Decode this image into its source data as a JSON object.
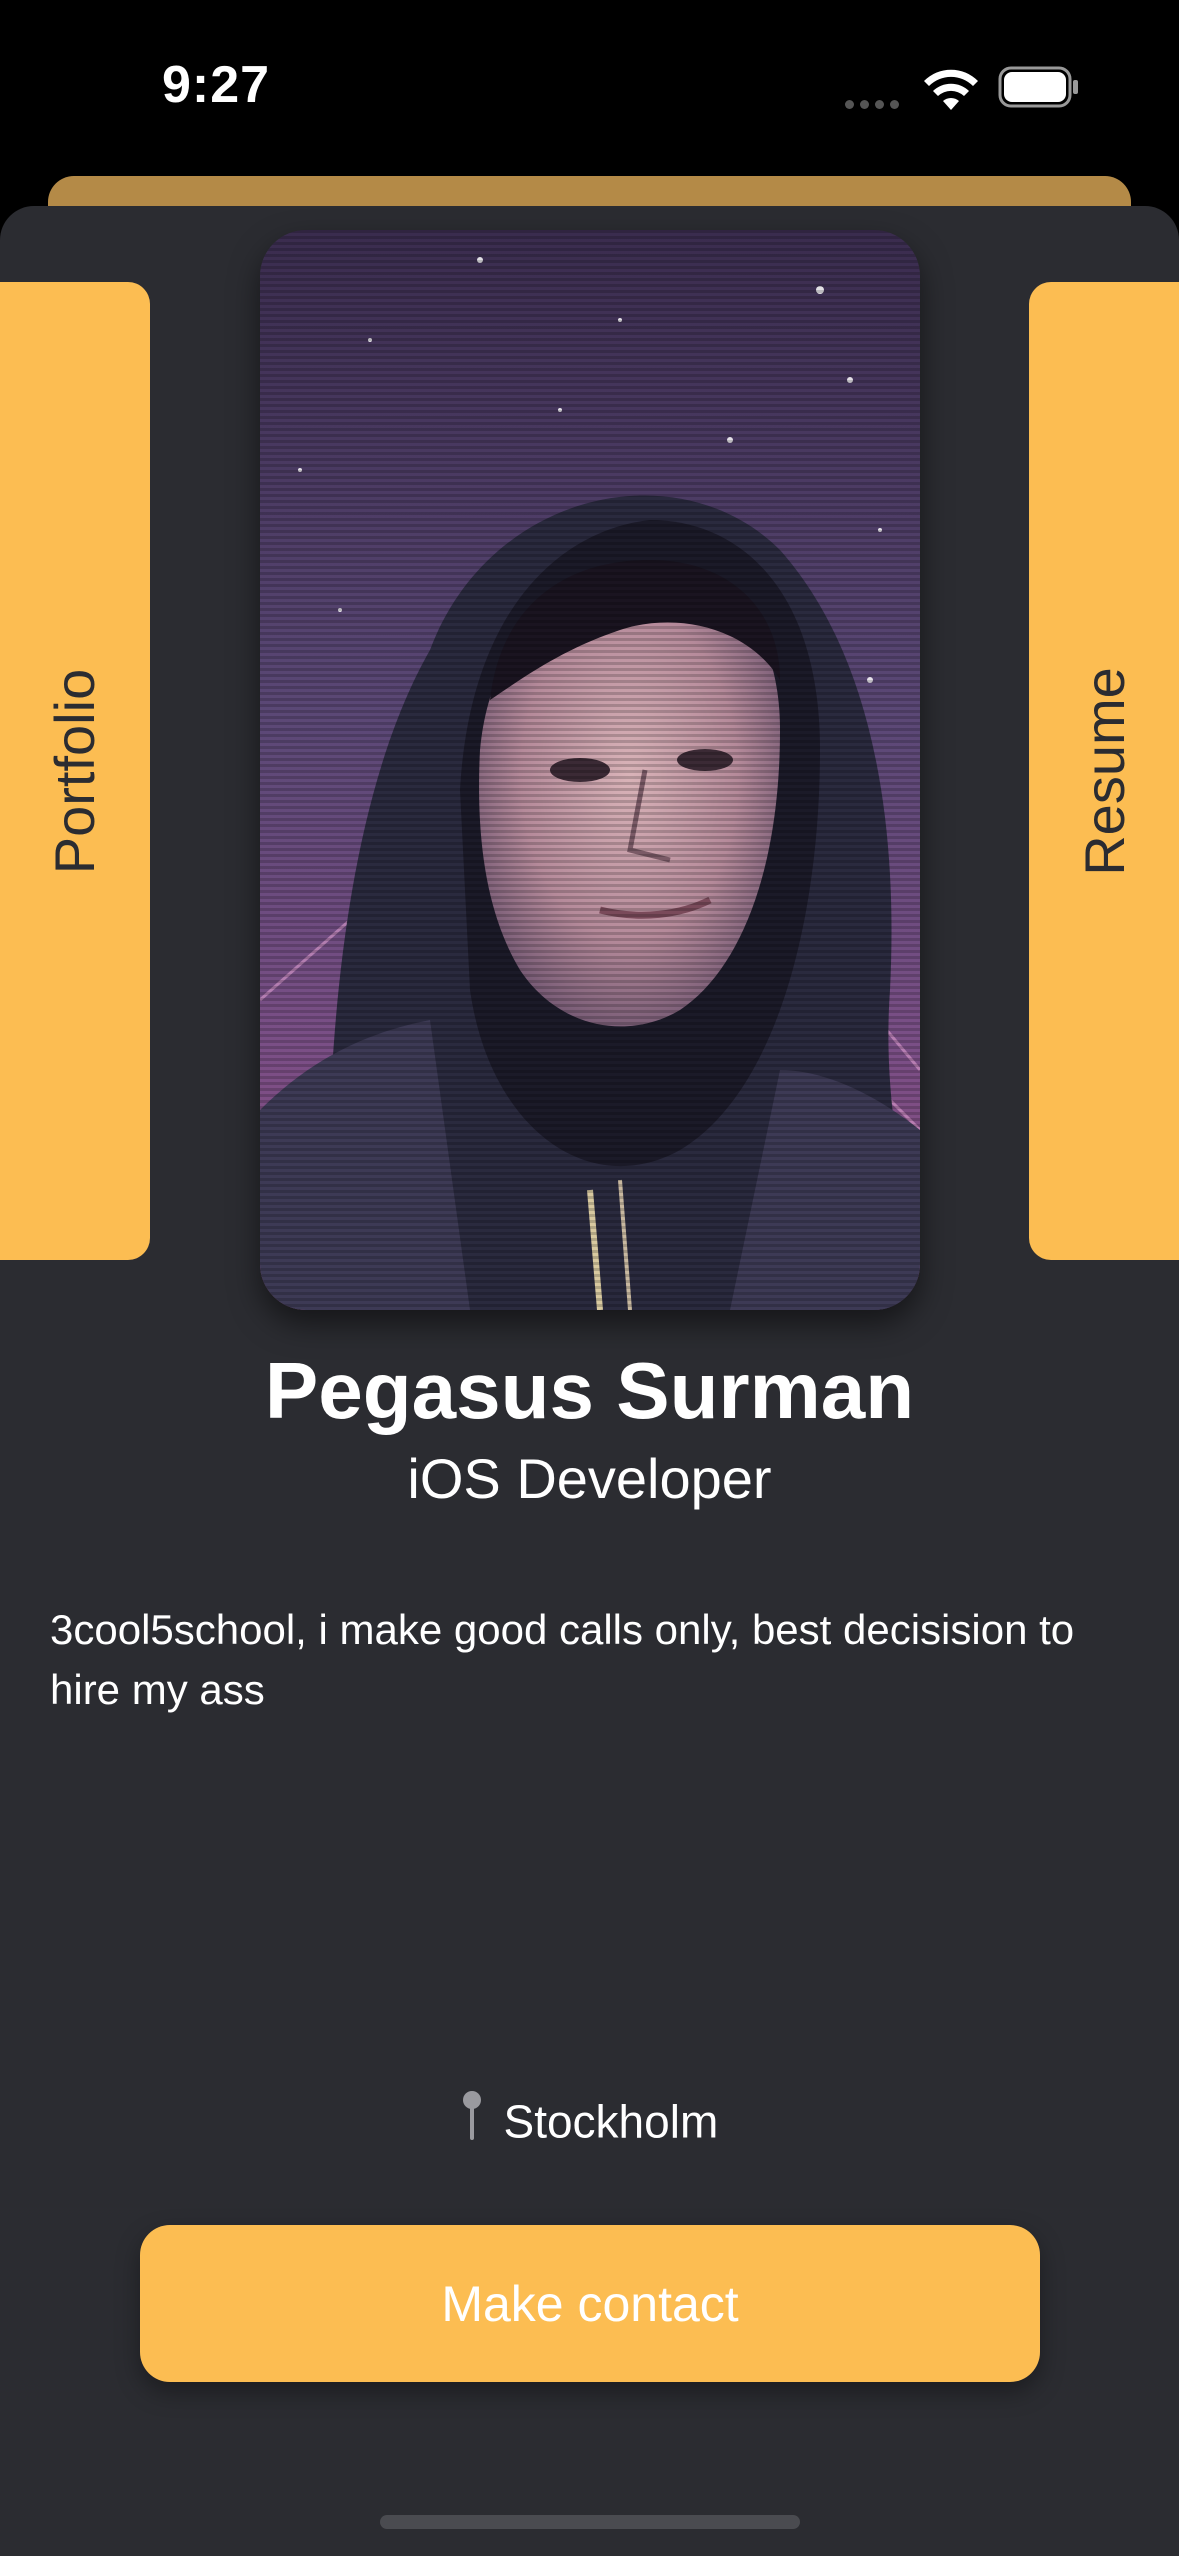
{
  "status_bar": {
    "time": "9:27"
  },
  "tabs": {
    "left_label": "Portfolio",
    "right_label": "Resume"
  },
  "profile": {
    "name": "Pegasus Surman",
    "role": "iOS Developer",
    "bio": "3cool5school, i make good calls only, best decisision to hire my ass",
    "location": "Stockholm"
  },
  "actions": {
    "contact_label": "Make contact"
  },
  "colors": {
    "accent": "#fcbd52",
    "sheet_background": "#2b2c31",
    "back_card": "#b48a47",
    "text": "#ffffff"
  },
  "icons": {
    "wifi": "wifi-icon",
    "battery": "battery-icon",
    "location": "map-pin-icon"
  }
}
